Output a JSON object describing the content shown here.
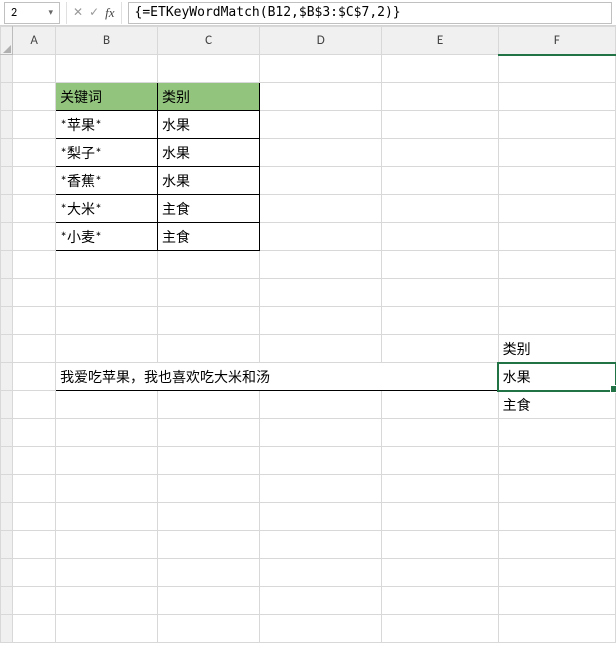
{
  "name_box": {
    "value": "2"
  },
  "formula_bar": {
    "fx_label": "fx",
    "value": "{=ETKeyWordMatch(B12,$B$3:$C$7,2)}"
  },
  "columns": [
    "A",
    "B",
    "C",
    "D",
    "E",
    "F"
  ],
  "keyword_table": {
    "headers": {
      "keyword": "关键词",
      "category": "类别"
    },
    "rows": [
      {
        "keyword": "*苹果*",
        "category": "水果"
      },
      {
        "keyword": "*梨子*",
        "category": "水果"
      },
      {
        "keyword": "*香蕉*",
        "category": "水果"
      },
      {
        "keyword": "*大米*",
        "category": "主食"
      },
      {
        "keyword": "*小麦*",
        "category": "主食"
      }
    ]
  },
  "sentence_cell": "我爱吃苹果，我也喜欢吃大米和汤",
  "result": {
    "header": "类别",
    "values": [
      "水果",
      "主食"
    ]
  },
  "colors": {
    "table_header_bg": "#92c47d",
    "selection": "#217346"
  }
}
